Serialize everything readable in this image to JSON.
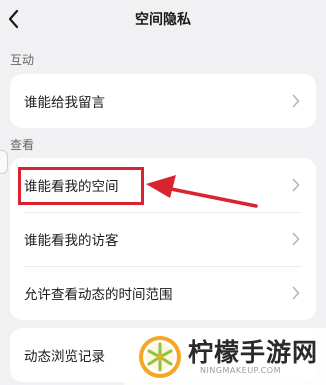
{
  "header": {
    "title": "空间隐私"
  },
  "sections": [
    {
      "label": "互动",
      "items": [
        {
          "label": "谁能给我留言"
        }
      ]
    },
    {
      "label": "查看",
      "items": [
        {
          "label": "谁能看我的空间"
        },
        {
          "label": "谁能看我的访客"
        },
        {
          "label": "允许查看动态的时间范围"
        }
      ]
    },
    {
      "label": "",
      "items": [
        {
          "label": "动态浏览记录"
        }
      ]
    }
  ],
  "annotation": {
    "highlight_color": "#d9232e",
    "target": "谁能看我的空间"
  },
  "watermark": {
    "brand": "柠檬手游网",
    "url": "NINGMAKEUP.COM"
  },
  "icons": {
    "back": "chevron-left-icon",
    "row_chevron": "chevron-right-icon"
  }
}
